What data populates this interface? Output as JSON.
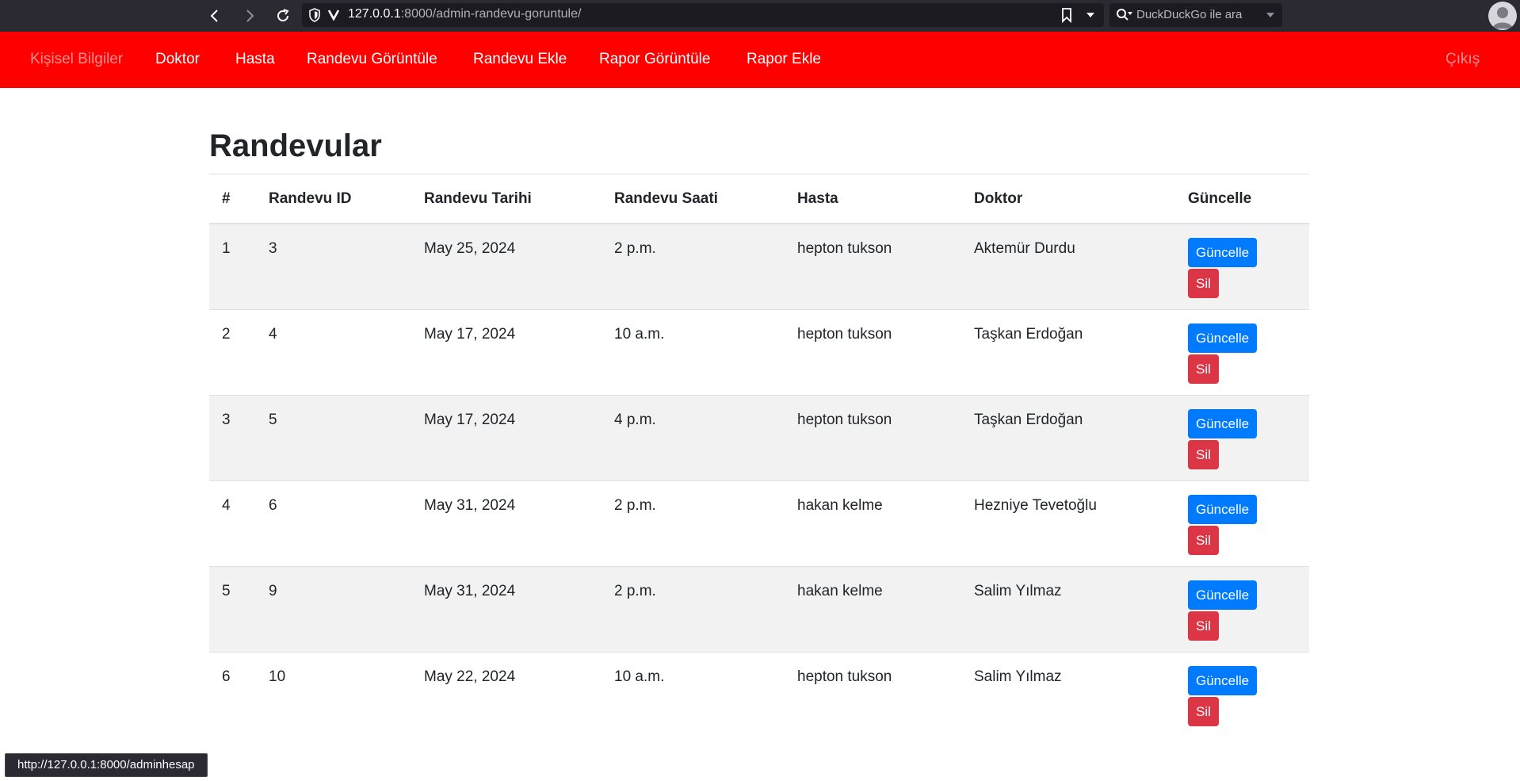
{
  "browser": {
    "url_host": "127.0.0.1",
    "url_path": ":8000/admin-randevu-goruntule/",
    "search_placeholder": "DuckDuckGo ile ara"
  },
  "nav": {
    "items": [
      {
        "label": "Kişisel Bilgiler"
      },
      {
        "label": "Doktor"
      },
      {
        "label": "Hasta"
      },
      {
        "label": "Randevu Görüntüle"
      },
      {
        "label": "Randevu Ekle"
      },
      {
        "label": "Rapor Görüntüle"
      },
      {
        "label": "Rapor Ekle"
      }
    ],
    "logout": "Çıkış"
  },
  "page": {
    "title": "Randevular",
    "columns": [
      "#",
      "Randevu ID",
      "Randevu Tarihi",
      "Randevu Saati",
      "Hasta",
      "Doktor",
      "Güncelle"
    ],
    "rows": [
      {
        "no": "1",
        "id": "3",
        "date": "May 25, 2024",
        "time": "2 p.m.",
        "patient": "hepton tukson",
        "doctor": "Aktemür Durdu"
      },
      {
        "no": "2",
        "id": "4",
        "date": "May 17, 2024",
        "time": "10 a.m.",
        "patient": "hepton tukson",
        "doctor": "Taşkan Erdoğan"
      },
      {
        "no": "3",
        "id": "5",
        "date": "May 17, 2024",
        "time": "4 p.m.",
        "patient": "hepton tukson",
        "doctor": "Taşkan Erdoğan"
      },
      {
        "no": "4",
        "id": "6",
        "date": "May 31, 2024",
        "time": "2 p.m.",
        "patient": "hakan kelme",
        "doctor": "Hezniye Tevetoğlu"
      },
      {
        "no": "5",
        "id": "9",
        "date": "May 31, 2024",
        "time": "2 p.m.",
        "patient": "hakan kelme",
        "doctor": "Salim Yılmaz"
      },
      {
        "no": "6",
        "id": "10",
        "date": "May 22, 2024",
        "time": "10 a.m.",
        "patient": "hepton tukson",
        "doctor": "Salim Yılmaz"
      }
    ],
    "update_label": "Güncelle",
    "delete_label": "Sil"
  },
  "status_url": "http://127.0.0.1:8000/adminhesap",
  "colors": {
    "navbar": "#ff0000",
    "primary": "#007bff",
    "danger": "#dc3545",
    "stripe": "#f2f2f2"
  }
}
